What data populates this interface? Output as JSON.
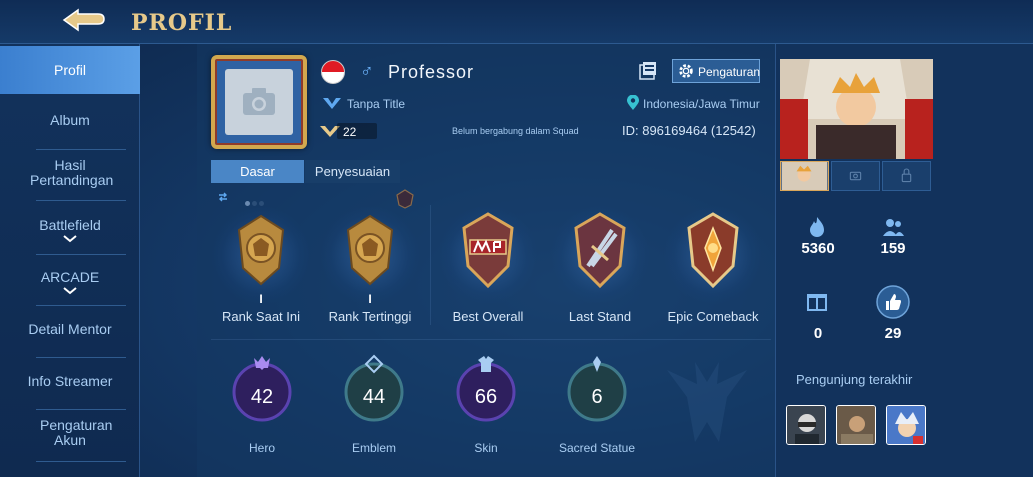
{
  "header": {
    "title": "PROFIL",
    "back_icon": "back-arrow-icon"
  },
  "sidebar": {
    "items": [
      {
        "label": "Profil",
        "active": true
      },
      {
        "label": "Album"
      },
      {
        "label": "Hasil Pertandingan"
      },
      {
        "label": "Battlefield"
      },
      {
        "label": "ARCADE"
      },
      {
        "label": "Detail Mentor"
      },
      {
        "label": "Info Streamer"
      },
      {
        "label": "Pengaturan Akun"
      }
    ]
  },
  "profile": {
    "name": "Professor",
    "gender_symbol": "♂",
    "title": "Tanpa Title",
    "level": "22",
    "squad_status": "Belum bergabung dalam Squad",
    "location": "Indonesia/Jawa Timur",
    "id": "ID: 896169464 (12542)",
    "settings_label": "Pengaturan"
  },
  "tabs": [
    {
      "label": "Dasar",
      "active": true
    },
    {
      "label": "Penyesuaian"
    }
  ],
  "achievements": [
    {
      "label": "Rank Saat Ini",
      "tier": "I"
    },
    {
      "label": "Rank Tertinggi",
      "tier": "I"
    },
    {
      "label": "Best Overall"
    },
    {
      "label": "Last Stand"
    },
    {
      "label": "Epic Comeback"
    }
  ],
  "stats": [
    {
      "value": "42",
      "label": "Hero"
    },
    {
      "value": "44",
      "label": "Emblem"
    },
    {
      "value": "66",
      "label": "Skin"
    },
    {
      "value": "6",
      "label": "Sacred Statue"
    }
  ],
  "right": {
    "popularity": "5360",
    "followers": "159",
    "gifts": "0",
    "likes": "29",
    "visitors_label": "Pengunjung terakhir"
  },
  "colors": {
    "accent": "#4a86c6",
    "gold": "#e6c98a",
    "panel": "#12325c"
  }
}
